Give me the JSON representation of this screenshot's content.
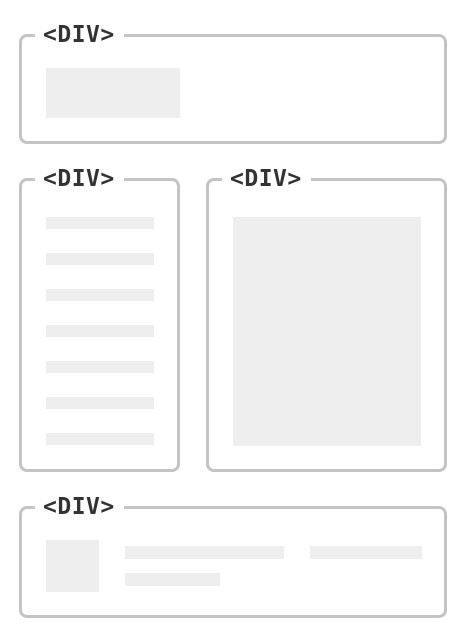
{
  "boxes": {
    "top": {
      "tag": "<DIV>"
    },
    "left": {
      "tag": "<DIV>"
    },
    "right": {
      "tag": "<DIV>"
    },
    "bottom": {
      "tag": "<DIV>"
    }
  },
  "colors": {
    "border": "#c4c4c4",
    "placeholder": "#eeeeee",
    "tag_text": "#333333",
    "background": "#ffffff"
  }
}
